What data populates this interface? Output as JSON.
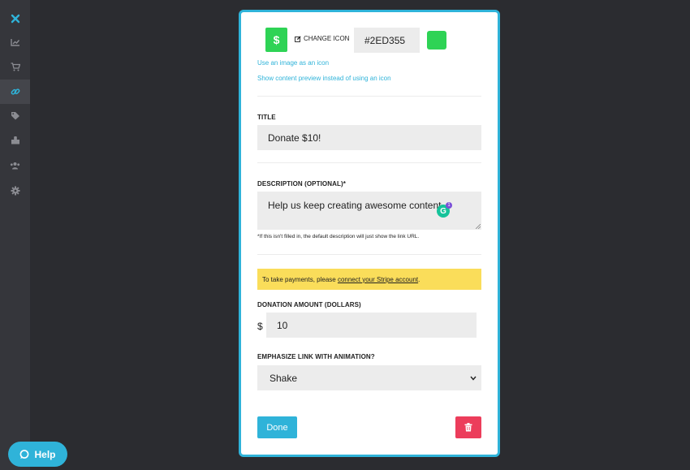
{
  "sidebar": {
    "items": [
      {
        "icon": "close-x-icon",
        "active": false
      },
      {
        "icon": "analytics-chart-icon",
        "active": false
      },
      {
        "icon": "cart-icon",
        "active": false
      },
      {
        "icon": "link-icon",
        "active": true
      },
      {
        "icon": "tags-icon",
        "active": false
      },
      {
        "icon": "puzzle-icon",
        "active": false
      },
      {
        "icon": "users-icon",
        "active": false
      },
      {
        "icon": "gear-icon",
        "active": false
      }
    ]
  },
  "help": {
    "label": "Help",
    "icon": "chat-bubble-icon"
  },
  "editor": {
    "icon_glyph": "$",
    "change_icon_label": "CHANGE ICON",
    "color_hex": "#2ED355",
    "use_image_link": "Use an image as an icon",
    "content_preview_link": "Show content preview instead of using an icon",
    "title_label": "TITLE",
    "title_value": "Donate $10!",
    "description_label": "DESCRIPTION (OPTIONAL)*",
    "description_value": "Help us keep creating awesome content.",
    "description_hint": "*If this isn't filled in, the default description will just show the link URL.",
    "notice_prefix": "To take payments, please ",
    "notice_link": "connect your Stripe account",
    "notice_suffix": ".",
    "amount_label": "DONATION AMOUNT (DOLLARS)",
    "currency_symbol": "$",
    "amount_value": "10",
    "animation_label": "EMPHASIZE LINK WITH ANIMATION?",
    "animation_value": "Shake",
    "done_label": "Done",
    "grammarly_glyph": "G",
    "grammarly_count": "1"
  },
  "colors": {
    "accent": "#2fb3d9",
    "icon_color": "#2ED355",
    "danger": "#ec3d5b",
    "notice": "#fadd5a"
  }
}
